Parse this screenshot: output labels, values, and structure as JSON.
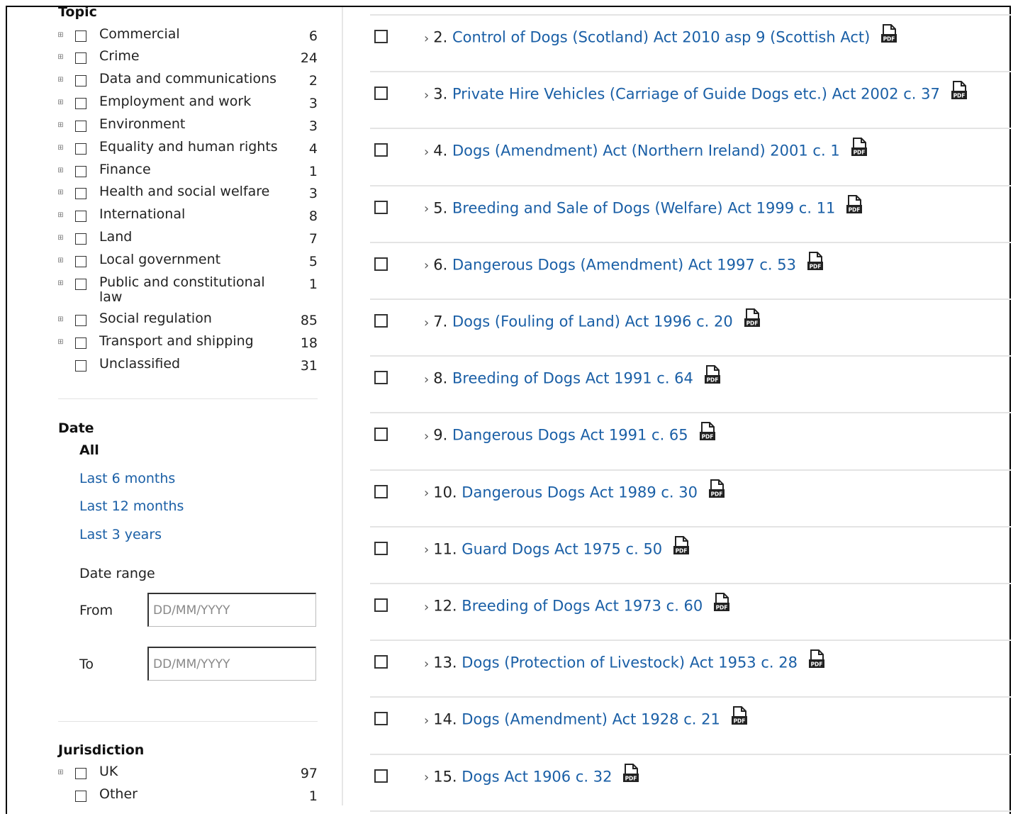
{
  "topic": {
    "title": "Topic",
    "items": [
      {
        "label": "Commercial",
        "count": "6",
        "expandable": true
      },
      {
        "label": "Crime",
        "count": "24",
        "expandable": true
      },
      {
        "label": "Data and communications",
        "count": "2",
        "expandable": true
      },
      {
        "label": "Employment and work",
        "count": "3",
        "expandable": true
      },
      {
        "label": "Environment",
        "count": "3",
        "expandable": true
      },
      {
        "label": "Equality and human rights",
        "count": "4",
        "expandable": true
      },
      {
        "label": "Finance",
        "count": "1",
        "expandable": true
      },
      {
        "label": "Health and social welfare",
        "count": "3",
        "expandable": true
      },
      {
        "label": "International",
        "count": "8",
        "expandable": true
      },
      {
        "label": "Land",
        "count": "7",
        "expandable": true
      },
      {
        "label": "Local government",
        "count": "5",
        "expandable": true
      },
      {
        "label": "Public and constitutional law",
        "count": "1",
        "expandable": true
      },
      {
        "label": "Social regulation",
        "count": "85",
        "expandable": true
      },
      {
        "label": "Transport and shipping",
        "count": "18",
        "expandable": true
      },
      {
        "label": "Unclassified",
        "count": "31",
        "expandable": false
      }
    ]
  },
  "date": {
    "title": "Date",
    "selected": "All",
    "links": [
      "Last 6 months",
      "Last 12 months",
      "Last 3 years"
    ],
    "range_label": "Date range",
    "from_label": "From",
    "to_label": "To",
    "placeholder": "DD/MM/YYYY"
  },
  "jurisdiction": {
    "title": "Jurisdiction",
    "items": [
      {
        "label": "UK",
        "count": "97",
        "expandable": true
      },
      {
        "label": "Other",
        "count": "1",
        "expandable": false
      }
    ]
  },
  "results": [
    {
      "num": "2.",
      "title": "Control of Dogs (Scotland) Act 2010 asp 9 (Scottish Act)"
    },
    {
      "num": "3.",
      "title": "Private Hire Vehicles (Carriage of Guide Dogs etc.) Act 2002 c. 37"
    },
    {
      "num": "4.",
      "title": "Dogs (Amendment) Act (Northern Ireland) 2001 c. 1"
    },
    {
      "num": "5.",
      "title": "Breeding and Sale of Dogs (Welfare) Act 1999 c. 11"
    },
    {
      "num": "6.",
      "title": "Dangerous Dogs (Amendment) Act 1997 c. 53"
    },
    {
      "num": "7.",
      "title": "Dogs (Fouling of Land) Act 1996 c. 20"
    },
    {
      "num": "8.",
      "title": "Breeding of Dogs Act 1991 c. 64"
    },
    {
      "num": "9.",
      "title": "Dangerous Dogs Act 1991 c. 65"
    },
    {
      "num": "10.",
      "title": "Dangerous Dogs Act 1989 c. 30"
    },
    {
      "num": "11.",
      "title": "Guard Dogs Act 1975 c. 50"
    },
    {
      "num": "12.",
      "title": "Breeding of Dogs Act 1973 c. 60"
    },
    {
      "num": "13.",
      "title": "Dogs (Protection of Livestock) Act 1953 c. 28"
    },
    {
      "num": "14.",
      "title": "Dogs (Amendment) Act 1928 c. 21"
    },
    {
      "num": "15.",
      "title": "Dogs Act 1906 c. 32"
    }
  ]
}
